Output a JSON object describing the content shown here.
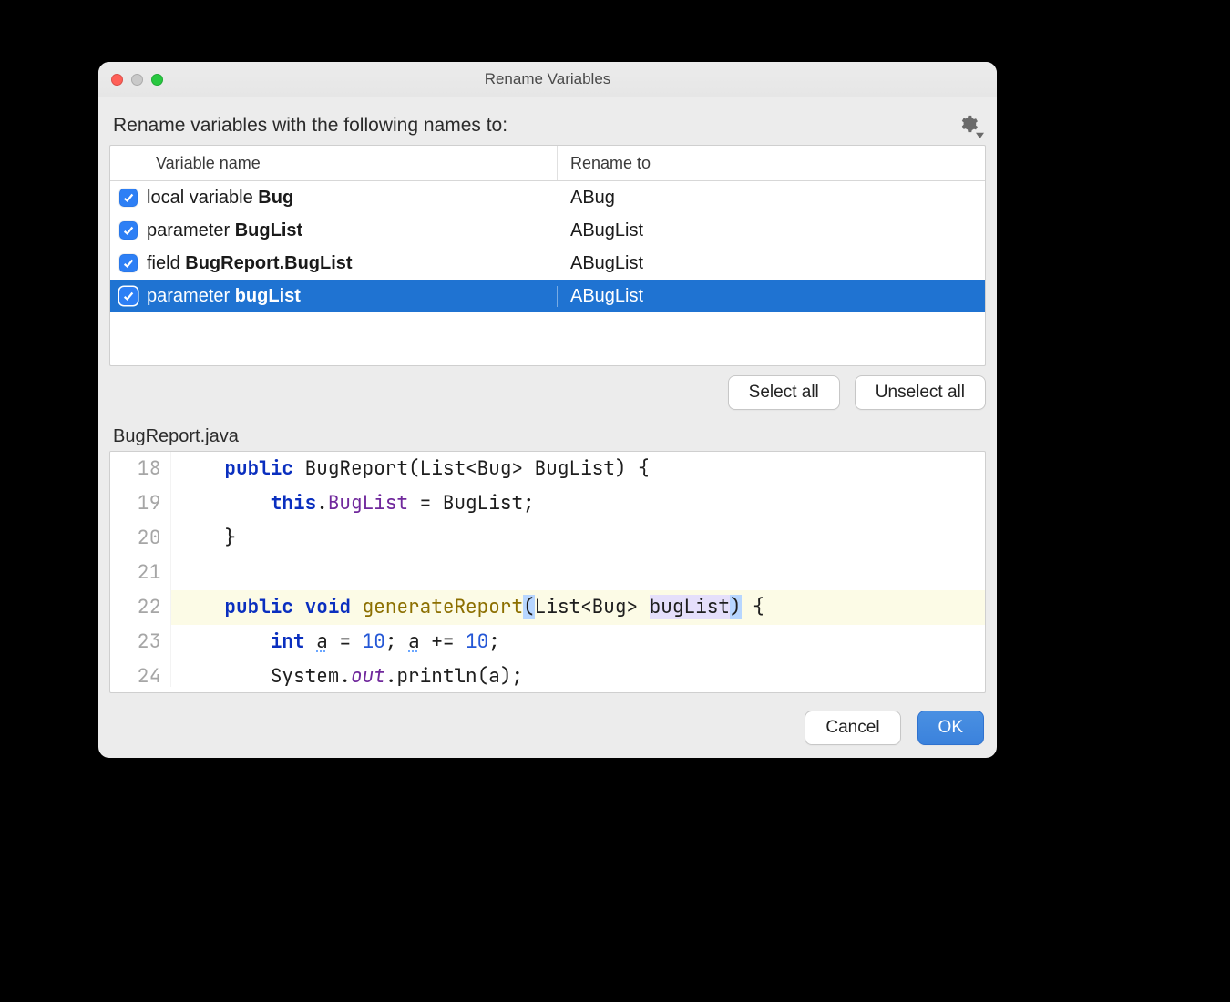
{
  "title": "Rename Variables",
  "headline": "Rename variables with the following names to:",
  "columns": {
    "name": "Variable name",
    "rename": "Rename to"
  },
  "rows": [
    {
      "checked": true,
      "selected": false,
      "kind": "local variable",
      "ident": "Bug",
      "rename": "ABug"
    },
    {
      "checked": true,
      "selected": false,
      "kind": "parameter",
      "ident": "BugList",
      "rename": "ABugList"
    },
    {
      "checked": true,
      "selected": false,
      "kind": "field",
      "ident": "BugReport.BugList",
      "rename": "ABugList"
    },
    {
      "checked": true,
      "selected": true,
      "kind": "parameter",
      "ident": "bugList",
      "rename": "ABugList"
    }
  ],
  "buttons": {
    "select_all": "Select all",
    "unselect_all": "Unselect all",
    "cancel": "Cancel",
    "ok": "OK"
  },
  "file_label": "BugReport.java",
  "code": {
    "lines": [
      18,
      19,
      20,
      21,
      22,
      23,
      24
    ],
    "l18": {
      "kw1": "public",
      "ctor": "BugReport",
      "paren_l": "(",
      "ptype": "List",
      "lt": "<",
      "parg": "Bug",
      "gt": ">",
      "pname": " BugList",
      "paren_r": ")",
      "brace": " {"
    },
    "l19": {
      "this": "this",
      "dot": ".",
      "field": "BugList",
      "eq": " = ",
      "rhs": "BugList",
      "semi": ";"
    },
    "l20": {
      "brace": "}"
    },
    "l22": {
      "kw1": "public",
      "kw2": "void",
      "m": "generateReport",
      "paren_l": "(",
      "ptype": "List",
      "lt": "<",
      "parg": "Bug",
      "gt": ">",
      "pname": "bugList",
      "paren_r": ")",
      "brace": " {"
    },
    "l23": {
      "kw": "int",
      "a1": "a",
      "eq": " = ",
      "n1": "10",
      "semi1": "; ",
      "a2": "a",
      "peq": " += ",
      "n2": "10",
      "semi2": ";"
    },
    "l24": {
      "sys": "System",
      "dot": ".",
      "out": "out",
      "dot2": ".",
      "m": "println",
      "paren_l": "(",
      "arg": "a",
      "paren_r": ")",
      "semi": ";"
    }
  }
}
